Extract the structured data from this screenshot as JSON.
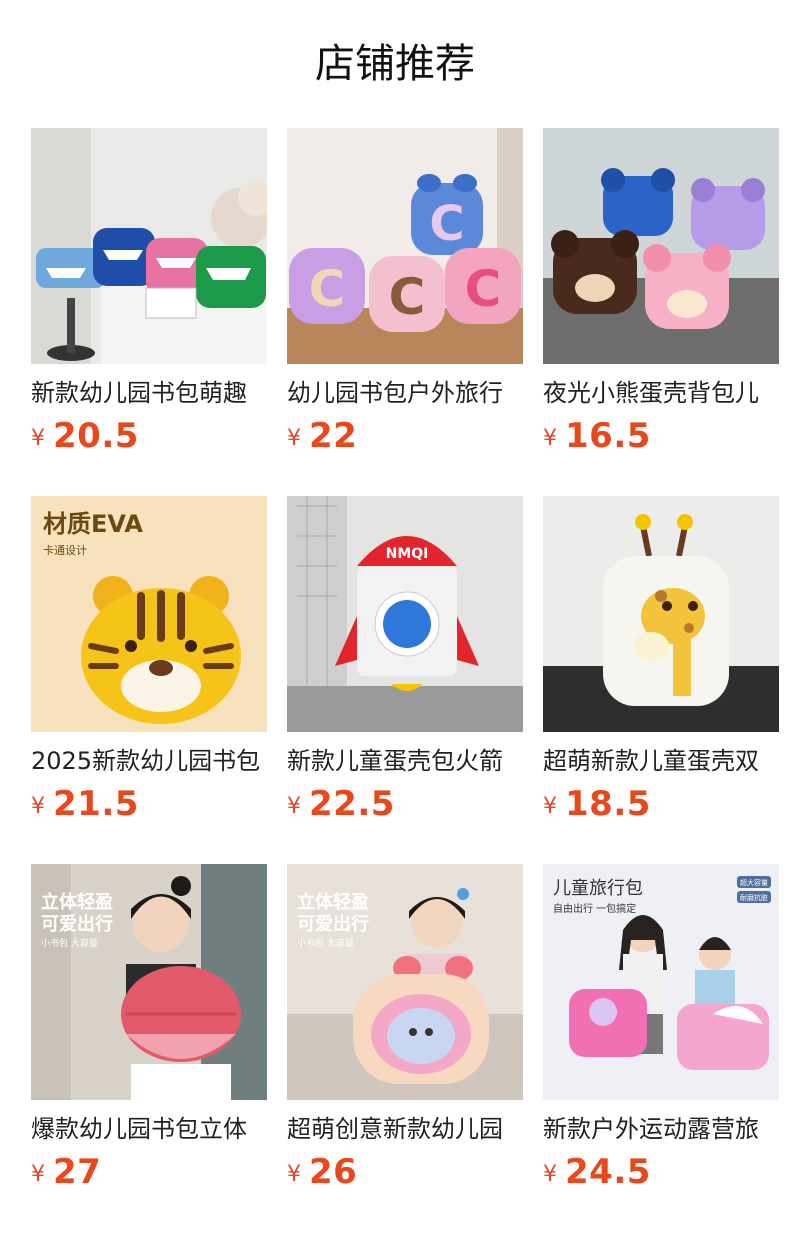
{
  "header": {
    "title": "店铺推荐"
  },
  "colors": {
    "price": "#e8481c",
    "text": "#222222"
  },
  "products": [
    {
      "name": "新款幼儿园书包萌趣",
      "currency": "¥",
      "price": "20.5",
      "image": "boat-backpacks-photo"
    },
    {
      "name": "幼儿园书包户外旅行",
      "currency": "¥",
      "price": "22",
      "image": "letter-c-backpacks-photo"
    },
    {
      "name": "夜光小熊蛋壳背包儿",
      "currency": "¥",
      "price": "16.5",
      "image": "bear-backpacks-photo"
    },
    {
      "name": "2025新款幼儿园书包",
      "currency": "¥",
      "price": "21.5",
      "image": "tiger-backpack-photo",
      "image_text": {
        "headline": "材质EVA",
        "sub": "卡通设计"
      }
    },
    {
      "name": "新款儿童蛋壳包火箭",
      "currency": "¥",
      "price": "22.5",
      "image": "rocket-backpack-photo",
      "image_text": {
        "brand": "NMQI"
      }
    },
    {
      "name": "超萌新款儿童蛋壳双",
      "currency": "¥",
      "price": "18.5",
      "image": "giraffe-backpack-photo"
    },
    {
      "name": "爆款幼儿园书包立体",
      "currency": "¥",
      "price": "27",
      "image": "acorn-backpack-photo",
      "image_text": {
        "line1": "立体轻盈",
        "line2": "可爱出行",
        "line3": "小书包 大容量"
      }
    },
    {
      "name": "超萌创意新款幼儿园",
      "currency": "¥",
      "price": "26",
      "image": "watermelon-backpack-photo",
      "image_text": {
        "line1": "立体轻盈",
        "line2": "可爱出行",
        "line3": "小书包 大容量"
      }
    },
    {
      "name": "新款户外运动露营旅",
      "currency": "¥",
      "price": "24.5",
      "image": "travel-bag-photo",
      "image_text": {
        "line1": "儿童旅行包",
        "line2": "自由出行 一包搞定",
        "badge1": "超大容量",
        "badge2": "耐磨抗脏"
      }
    }
  ]
}
